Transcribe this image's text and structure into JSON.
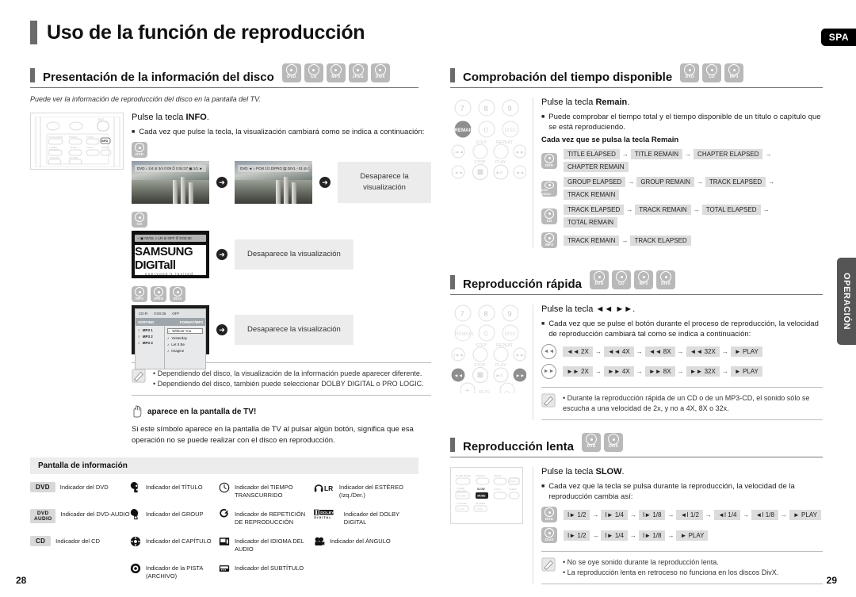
{
  "page": {
    "title": "Uso de la función de reproducción",
    "lang_badge": "SPA",
    "side_tab": "OPERACIÓN",
    "page_number_left": "28",
    "page_number_right": "29"
  },
  "section_disc_info": {
    "heading": "Presentación de la información del disco",
    "disc_icons": [
      "DVD",
      "CD",
      "MP3",
      "JPEG",
      "DivX"
    ],
    "intro": "Puede ver la información de reproducción del disco en la pantalla del TV.",
    "step_prefix": "Pulse la tecla ",
    "step_key": "INFO",
    "step_suffix": ".",
    "bullet": "Cada vez que pulse la tecla, la visualización cambiará como se indica a continuación:",
    "row1_icon": "DVD",
    "row1_end_note": "Desaparece la visualización",
    "row1_osd_1": "DVD  ♪ 1/4  ⊘ 3/4 0:08  ⏱ 0:04:37  ▣ 1/1 ►",
    "row1_osd_2": "DVD  ◄ ♪ PCM 1/1  D/PRO  ▤ DIV1 - 01  ⊘ OFF",
    "row2_icon": "CD",
    "row2_osd": "~  ▣ 02/15   ♫ LR   ⊘ OFF   ⏱ 0:02:30",
    "row2_splash_main": "SAMSUNG DIGITall",
    "row2_splash_sub": "everyone's invited.",
    "row2_end_note": "Desaparece la visualización",
    "row3_icons": [
      "MP3",
      "JPEG",
      "DivX"
    ],
    "row3_browser_top_left": "CD-R",
    "row3_browser_top_mid": "0:00:36",
    "row3_browser_top_right": "OFF",
    "row3_browser_bar_left": "SORTING",
    "row3_browser_bar_right": "FORMAT/MP3",
    "row3_browser_left_items": [
      "MP3 1",
      "MP3 2",
      "MP3 3"
    ],
    "row3_browser_right_items": [
      "Without You",
      "Yesterday",
      "Let It Be",
      "Imagine"
    ],
    "row3_end_note": "Desaparece la visualización",
    "notes": [
      "Dependiendo del disco, la visualización de la información puede aparecer diferente.",
      "Dependiendo del disco, también puede seleccionar DOLBY DIGITAL o PRO LOGIC."
    ],
    "hand_title": "aparece en la pantalla de TV!",
    "hand_paragraph": "Si este símbolo aparece en la pantalla de TV al pulsar algún botón, significa que esa operación no se puede realizar con el disco en reproducción."
  },
  "info_panel": {
    "heading": "Pantalla de información",
    "items": [
      {
        "badge": "DVD",
        "badge_type": "tag",
        "label": "Indicador del DVD"
      },
      {
        "badge": "TITLE",
        "badge_type": "icon",
        "icon": "title-icon",
        "label": "Indicador del TÍTULO"
      },
      {
        "badge": "CLOCK",
        "badge_type": "icon",
        "icon": "clock-icon",
        "label": "Indicador del TIEMPO TRANSCURRIDO"
      },
      {
        "badge": "STEREO",
        "badge_type": "icon",
        "icon": "headphone-lr-icon",
        "label": "Indicador del ESTÉREO (Izq./Der.)"
      },
      {
        "badge": "DVD AUDIO",
        "badge_type": "tag2",
        "label": "Indicador del DVD-AUDIO"
      },
      {
        "badge": "GROUP",
        "badge_type": "icon",
        "icon": "group-icon",
        "label": "Indicador del GROUP"
      },
      {
        "badge": "REPEAT",
        "badge_type": "icon",
        "icon": "repeat-icon",
        "label": "Indicador de REPETICIÓN DE REPRODUCCIÓN"
      },
      {
        "badge": "DOLBY",
        "badge_type": "icon",
        "icon": "dolby-digital-icon",
        "label": "Indicador del DOLBY DIGITAL"
      },
      {
        "badge": "CD",
        "badge_type": "tag",
        "label": "Indicador del CD"
      },
      {
        "badge": "CHAPTER",
        "badge_type": "icon",
        "icon": "chapter-icon",
        "label": "Indicador del CAPÍTULO"
      },
      {
        "badge": "AUDIO",
        "badge_type": "icon",
        "icon": "audio-lang-icon",
        "label": "Indicador del IDIOMA DEL AUDIO"
      },
      {
        "badge": "ANGLE",
        "badge_type": "icon",
        "icon": "angle-camera-icon",
        "label": "Indicador del ÁNGULO"
      },
      {
        "badge": "",
        "badge_type": "none",
        "label": ""
      },
      {
        "badge": "TRACK",
        "badge_type": "icon",
        "icon": "track-icon",
        "label": "Indicador de la PISTA (ARCHIVO)"
      },
      {
        "badge": "SUBTITLE",
        "badge_type": "icon",
        "icon": "subtitle-icon",
        "label": "Indicador del SUBTÍTULO"
      },
      {
        "badge": "",
        "badge_type": "none",
        "label": ""
      }
    ]
  },
  "section_remaining_time": {
    "heading": "Comprobación del tiempo disponible",
    "disc_icons": [
      "DVD",
      "CD",
      "MP3"
    ],
    "step_prefix": "Pulse la tecla ",
    "step_key": "Remain",
    "step_suffix": ".",
    "bullet": "Puede comprobar el tiempo total y el tiempo disponible de un título o capítulo que se está reproduciendo.",
    "sub_bold": "Cada vez que se pulsa la tecla Remain",
    "sequences": [
      {
        "icon": "DVD",
        "items": [
          "TITLE ELAPSED",
          "TITLE REMAIN",
          "CHAPTER ELAPSED",
          "CHAPTER REMAIN"
        ]
      },
      {
        "icon": "DVD-AUDIO",
        "items": [
          "GROUP ELAPSED",
          "GROUP REMAIN",
          "TRACK ELAPSED",
          "TRACK REMAIN"
        ]
      },
      {
        "icon": "CD",
        "items": [
          "TRACK ELAPSED",
          "TRACK REMAIN",
          "TOTAL ELAPSED",
          "TOTAL REMAIN"
        ]
      },
      {
        "icon": "MP3",
        "items": [
          "TRACK REMAIN",
          "TRACK ELAPSED"
        ]
      }
    ],
    "remote_key_label": "REMAIN"
  },
  "section_fast_play": {
    "heading": "Reproducción rápida",
    "disc_icons": [
      "DVD",
      "CD",
      "MP3",
      "DivX"
    ],
    "step_prefix": "Pulse la tecla ",
    "step_key": "◄◄ ►►",
    "step_suffix": ".",
    "bullet": "Cada vez que se pulse el botón durante el proceso de reproducción, la velocidad de reproducción cambiará tal como se indica a continuación:",
    "sequences": [
      {
        "button": "◄◄",
        "items": [
          "◄◄ 2X",
          "◄◄ 4X",
          "◄◄ 8X",
          "◄◄ 32X",
          "► PLAY"
        ]
      },
      {
        "button": "►►",
        "items": [
          "►► 2X",
          "►► 4X",
          "►► 8X",
          "►► 32X",
          "► PLAY"
        ]
      }
    ],
    "note": "Durante la reproducción rápida de un CD o de un MP3-CD, el sonido sólo se escucha a una velocidad de 2x, y no a 4X, 8X o 32x."
  },
  "section_slow_play": {
    "heading": "Reproducción lenta",
    "disc_icons": [
      "DVD",
      "DivX"
    ],
    "step_prefix": "Pulse la tecla ",
    "step_key": "SLOW",
    "step_suffix": ".",
    "bullet": "Cada vez que la tecla se pulsa  durante la reproducción, la velocidad de la reproducción cambia así:",
    "sequences": [
      {
        "icon": "DVD",
        "items": [
          "I► 1/2",
          "I► 1/4",
          "I► 1/8",
          "◄I 1/2",
          "◄I 1/4",
          "◄I 1/8",
          "► PLAY"
        ]
      },
      {
        "icon": "DivX",
        "items": [
          "I► 1/2",
          "I► 1/4",
          "I► 1/8",
          "► PLAY"
        ]
      }
    ],
    "notes": [
      "No se oye sonido durante la reproducción lenta.",
      "La reproducción lenta en retroceso no funciona en los discos DivX."
    ],
    "remote_key_label": "SLOW",
    "remote_labels": [
      "SLIDE MODE",
      "DISSET",
      "ZOOM",
      "INFO",
      "TUNER MEMORY",
      "SLOW",
      "LOGO",
      "SLEEP",
      "SOUND",
      "MODE",
      "V-SOUND",
      "EZ VIEW",
      "S.HAT",
      "VTRN"
    ]
  },
  "remote_left": {
    "labels_top": [
      "TUNER",
      "EXIT"
    ],
    "labels_grid": [
      "SLIDE MODE",
      "DISSET",
      "ZOOM",
      "INFO",
      "TUNER MEMORY",
      "SLOW",
      "LOGO",
      "SLEEP",
      "SOUND",
      "MODE",
      "V-SOUND",
      "EZ VIEW",
      "S.HAT",
      "VTRN"
    ],
    "highlight_key": "INFO"
  },
  "remote_keypad": {
    "rows": [
      [
        "7",
        "8",
        "9"
      ],
      [
        "REMAIN",
        "0",
        "DISC"
      ]
    ],
    "labels": [
      "STEP",
      "REPEAT",
      "STOP",
      "PLAY"
    ],
    "mute_label": "MUTE"
  },
  "colors": {
    "accent_bar": "#6b6b6b",
    "chip_bg": "#dcdcdc",
    "panel_bg": "#ececec",
    "badge_black": "#000000",
    "side_tab": "#555555"
  }
}
